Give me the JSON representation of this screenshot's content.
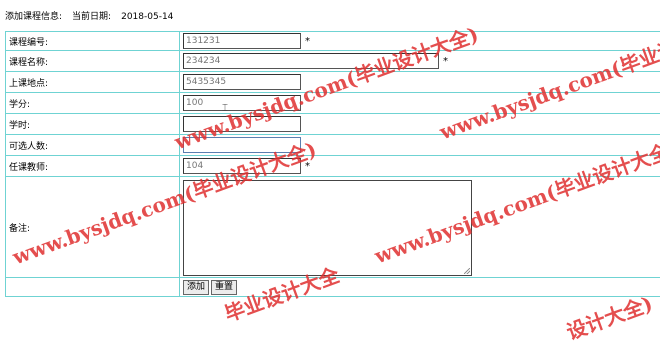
{
  "header": {
    "title": "添加课程信息:",
    "date_label": "当前日期:",
    "date_value": "2018-05-14"
  },
  "fields": {
    "course_no": {
      "label": "课程编号:",
      "value": "131231",
      "required": "*"
    },
    "course_name": {
      "label": "课程名称:",
      "value": "234234",
      "required": "*"
    },
    "location": {
      "label": "上课地点:",
      "value": "5435345"
    },
    "credits": {
      "label": "学分:",
      "value": "100"
    },
    "hours": {
      "label": "学时:",
      "value": ""
    },
    "capacity": {
      "label": "可选人数:",
      "value": ""
    },
    "teacher": {
      "label": "任课教师:",
      "value": "104",
      "required": "*"
    },
    "remarks": {
      "label": "备注:",
      "value": ""
    }
  },
  "buttons": {
    "add": "添加",
    "reset": "重置"
  },
  "watermark": {
    "text1": "www.bysjdq.com(毕业设计大全)",
    "text2": "www.bysjdq.com(毕业设计大全)",
    "text3": "www.bysjdq.com(毕业设计大全)",
    "text4": "www.bysjdq.com(毕业设计大全)",
    "text5": "毕业设计大全",
    "text6": "设计大全)",
    "color": "#e03030"
  }
}
